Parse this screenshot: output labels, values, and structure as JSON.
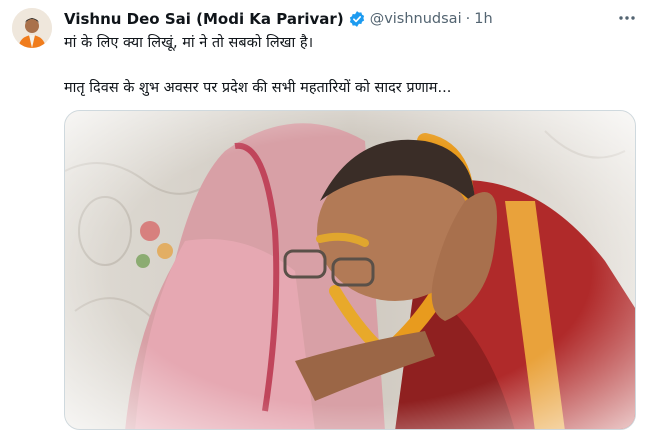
{
  "author": {
    "name": "Vishnu Deo Sai (Modi Ka Parivar)",
    "handle": "@vishnudsai",
    "separator": "·",
    "time": "1h",
    "verified": true,
    "avatar_icon": "profile-photo"
  },
  "tweet": {
    "line1": "मां के लिए क्या लिखूं, मां ने तो सबको लिखा है।",
    "line2": "मातृ दिवस के शुभ अवसर पर प्रदेश की सभी महतारियों को सादर प्रणाम..."
  },
  "icons": {
    "verified": "verified-badge-icon",
    "more": "more-options-icon"
  },
  "colors": {
    "verified_blue": "#1d9bf0",
    "secondary_text": "#536471",
    "primary_text": "#0f1419"
  }
}
